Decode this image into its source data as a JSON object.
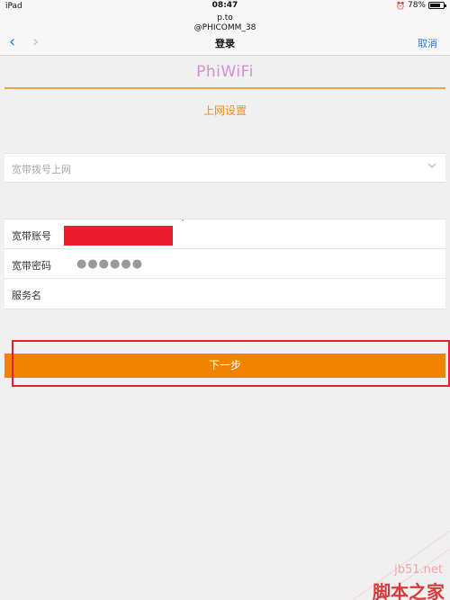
{
  "status_bar": {
    "device": "iPad",
    "time": "08:47",
    "battery": "78%",
    "battery_level": 0.78
  },
  "nav": {
    "url_line1": "p.to",
    "url_line2": "@PHICOMM_38",
    "title": "登录",
    "back_icon": "chevron-left-icon",
    "forward_icon": "chevron-right-icon",
    "cancel_label": "取消"
  },
  "page": {
    "logo": "PhiWiFi",
    "section_title": "上网设置",
    "connection_type": {
      "value": "宽带拨号上网",
      "icon": "chevron-down-icon"
    },
    "fields": {
      "account_label": "宽带账号",
      "password_label": "宽带密码",
      "password_value": "●●●●●●",
      "service_label": "服务名",
      "service_value": ""
    },
    "next_button": "下一步"
  },
  "watermark": {
    "site": "jb51.net",
    "name": "脚本之家"
  },
  "colors": {
    "accent_orange": "#f08300",
    "link_blue": "#2a7de1",
    "logo_pink": "#d58fd2",
    "annotation_red": "#e82129",
    "redaction_red": "#ed1c2e"
  }
}
